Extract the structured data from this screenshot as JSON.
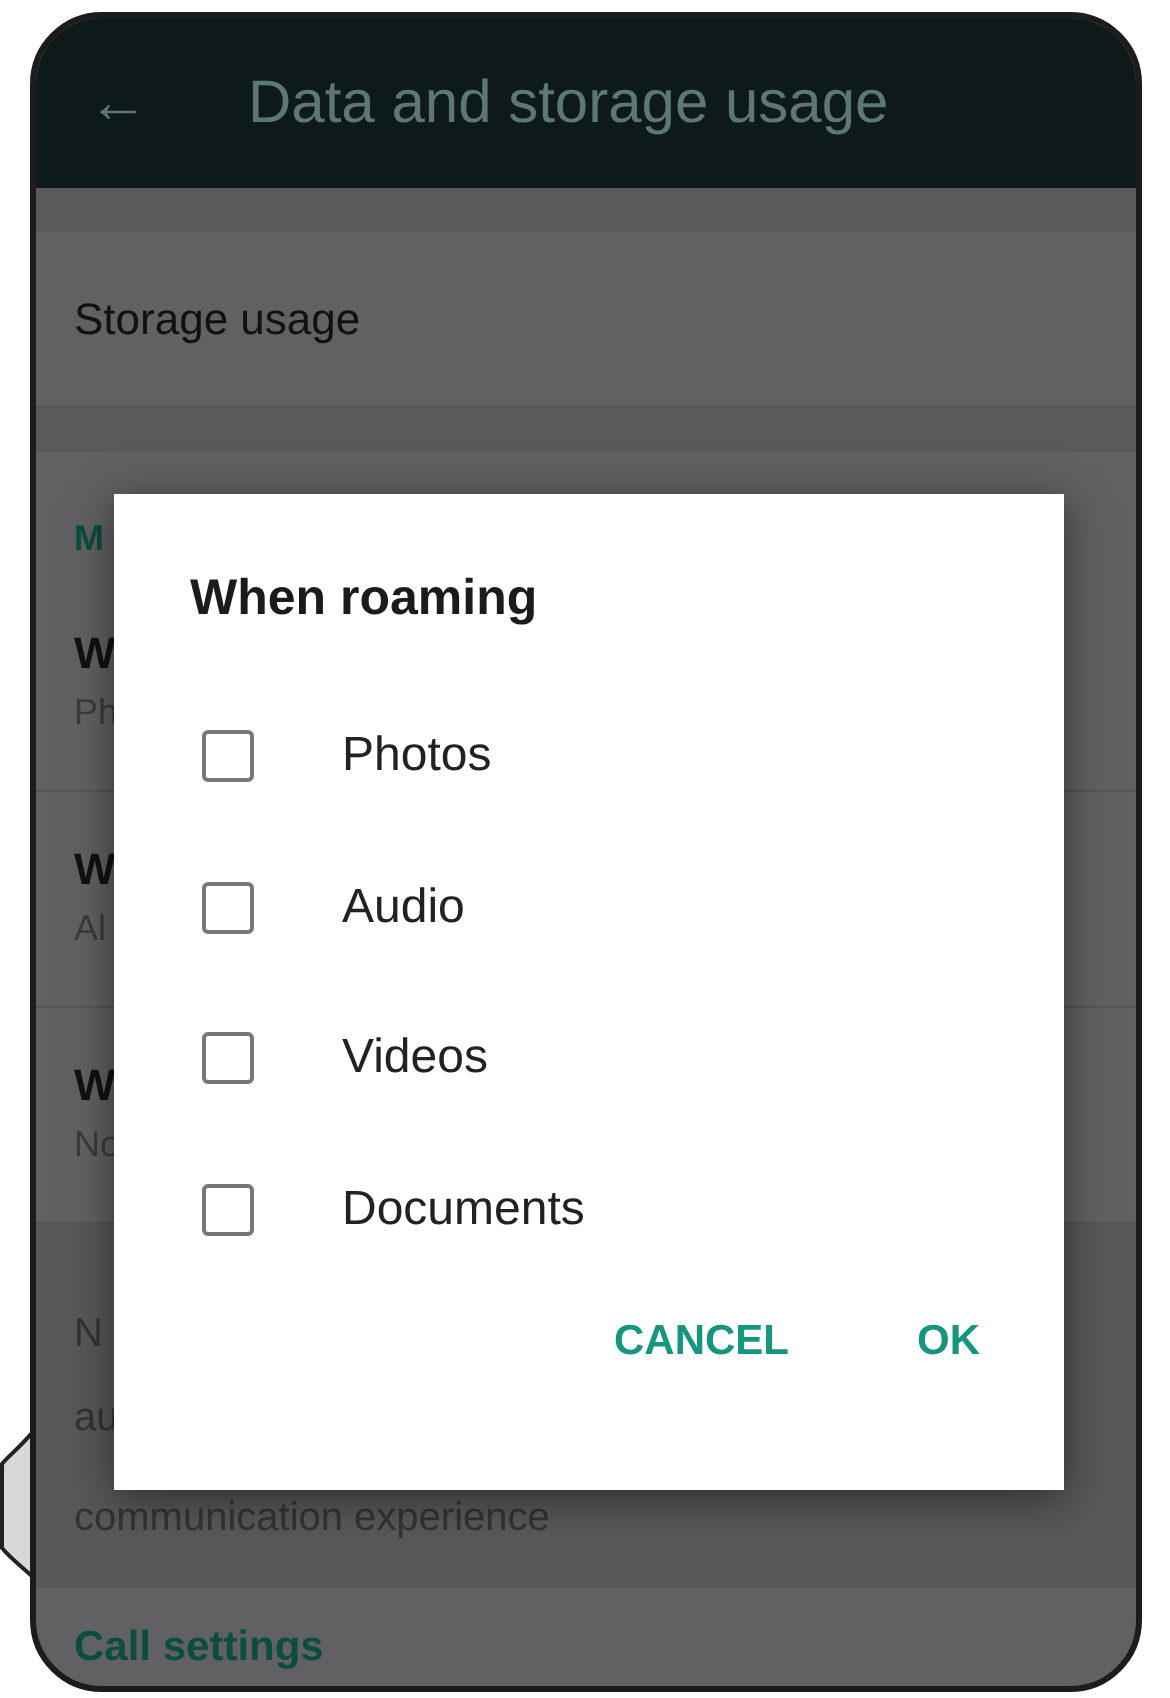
{
  "app_bar": {
    "back": "←",
    "title": "Data and storage usage"
  },
  "settings": {
    "storage_row": "Storage usage",
    "section_header": "M",
    "rows": [
      {
        "title": "W",
        "subtitle": "Ph"
      },
      {
        "title": "W",
        "subtitle": "Al"
      },
      {
        "title": "W",
        "subtitle": "No"
      }
    ],
    "note_lines": [
      "N",
      "au",
      "communication experience"
    ],
    "call_settings": "Call settings"
  },
  "dialog": {
    "title": "When roaming",
    "options": [
      {
        "label": "Photos",
        "checked": false
      },
      {
        "label": "Audio",
        "checked": false
      },
      {
        "label": "Videos",
        "checked": false
      },
      {
        "label": "Documents",
        "checked": false
      }
    ],
    "buttons": [
      "CANCEL",
      "OK"
    ]
  }
}
